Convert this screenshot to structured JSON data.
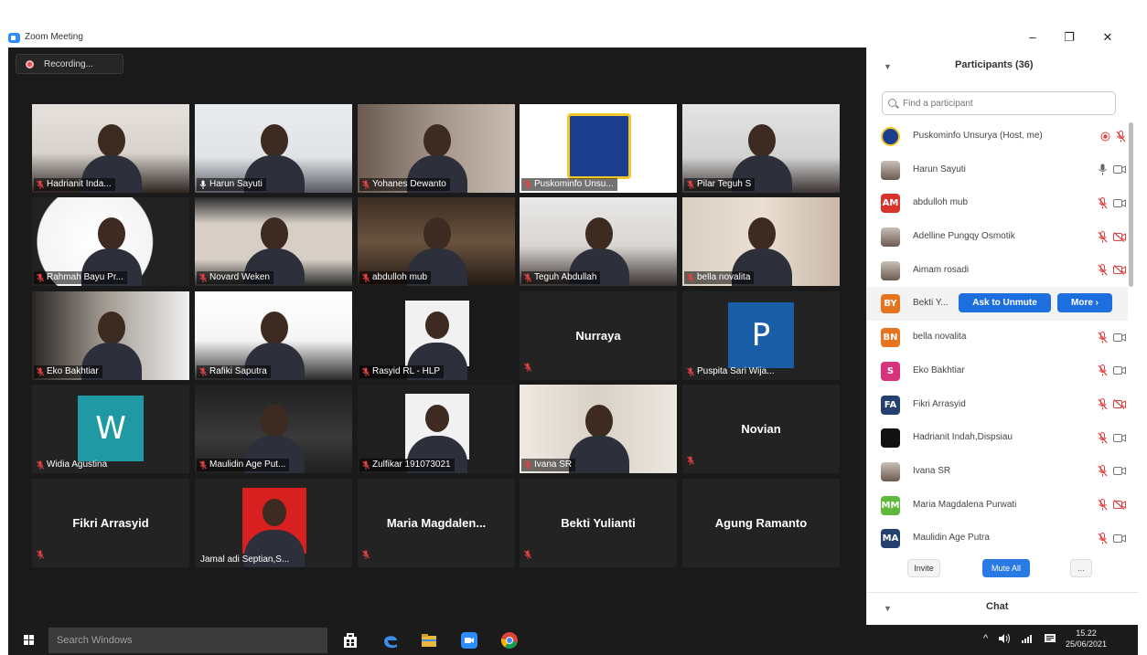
{
  "window": {
    "title": "Zoom Meeting",
    "controls": {
      "minimize": "–",
      "restore": "❐",
      "close": "✕"
    }
  },
  "recording": {
    "label": "Recording..."
  },
  "tiles": [
    {
      "name": "Hadrianit Inda...",
      "type": "video",
      "muted": true
    },
    {
      "name": "Harun Sayuti",
      "type": "video",
      "muted": false,
      "active": true
    },
    {
      "name": "Yohanes Dewanto",
      "type": "video",
      "muted": true
    },
    {
      "name": "Puskominfo Unsu...",
      "type": "video",
      "muted": true
    },
    {
      "name": "Pilar Teguh S",
      "type": "video",
      "muted": true
    },
    {
      "name": "Rahmah Bayu Pr...",
      "type": "video",
      "muted": true
    },
    {
      "name": "Novard Weken",
      "type": "video",
      "muted": true
    },
    {
      "name": "abdulloh mub",
      "type": "video",
      "muted": true
    },
    {
      "name": "Teguh Abdullah",
      "type": "video",
      "muted": true
    },
    {
      "name": "bella novalita",
      "type": "video",
      "muted": true
    },
    {
      "name": "Eko Bakhtiar",
      "type": "video",
      "muted": true
    },
    {
      "name": "Rafiki Saputra",
      "type": "video",
      "muted": true
    },
    {
      "name": "Rasyid RL - HLP",
      "type": "video",
      "muted": true
    },
    {
      "name": "Nurraya",
      "type": "name",
      "muted": true
    },
    {
      "name": "Puspita Sari Wija...",
      "type": "avatar",
      "letter": "P",
      "color": "#1a5ea8",
      "muted": true
    },
    {
      "name": "Widia Agustina",
      "type": "avatar",
      "letter": "W",
      "color": "#1f9aa5",
      "muted": true
    },
    {
      "name": "Maulidin Age Put...",
      "type": "video",
      "muted": true
    },
    {
      "name": "Zulfikar 191073021",
      "type": "video",
      "muted": true
    },
    {
      "name": "Ivana SR",
      "type": "video",
      "muted": true
    },
    {
      "name": "Novian",
      "type": "name",
      "muted": true
    },
    {
      "name": "Fikri Arrasyid",
      "type": "name",
      "muted": true
    },
    {
      "name": "Jamal adi Septian,S...",
      "type": "video",
      "muted": false
    },
    {
      "name": "Maria  Magdalen...",
      "type": "name",
      "muted": true
    },
    {
      "name": "Bekti Yulianti",
      "type": "name",
      "muted": true
    },
    {
      "name": "Agung Ramanto",
      "type": "name",
      "muted": false
    }
  ],
  "participants_panel": {
    "title": "Participants (36)",
    "search_placeholder": "Find a participant",
    "items": [
      {
        "name": "Puskominfo Unsurya (Host, me)",
        "avatar": "logo",
        "audio": "recording",
        "video": "mic-off"
      },
      {
        "name": "Harun Sayuti",
        "avatar": "photo",
        "audio": "mic-on",
        "video": "cam-on"
      },
      {
        "name": "abdulloh mub",
        "initials": "AM",
        "color": "#d9342b",
        "audio": "mic-off",
        "video": "cam-on"
      },
      {
        "name": "Adelline Pungqy Osmotik",
        "avatar": "photo",
        "audio": "mic-off",
        "video": "cam-off"
      },
      {
        "name": "Aimam rosadi",
        "avatar": "photo",
        "audio": "mic-off",
        "video": "cam-off"
      },
      {
        "name": "Bekti Y...",
        "initials": "BY",
        "color": "#e8731f",
        "ask_label": "Ask to Unmute",
        "more_label": "More ›"
      },
      {
        "name": "bella novalita",
        "initials": "BN",
        "color": "#e8731f",
        "audio": "mic-off",
        "video": "cam-on"
      },
      {
        "name": "Eko Bakhtiar",
        "initials": "S",
        "color": "#d6337a",
        "audio": "mic-off",
        "video": "cam-on"
      },
      {
        "name": "Fikri Arrasyid",
        "initials": "FA",
        "color": "#23406f",
        "audio": "mic-off",
        "video": "cam-off"
      },
      {
        "name": "Hadrianit Indah,Dispsiau",
        "avatar": "black",
        "audio": "mic-off",
        "video": "cam-on"
      },
      {
        "name": "Ivana SR",
        "avatar": "photo",
        "audio": "mic-off",
        "video": "cam-on"
      },
      {
        "name": "Maria Magdalena Purwati",
        "initials": "MM",
        "color": "#5fb83c",
        "audio": "mic-off",
        "video": "cam-off"
      },
      {
        "name": "Maulidin Age Putra",
        "initials": "MA",
        "color": "#23406f",
        "audio": "mic-off",
        "video": "cam-on"
      }
    ],
    "invite_label": "Invite",
    "mute_all_label": "Mute All",
    "more_label": "...",
    "chat_title": "Chat"
  },
  "taskbar": {
    "search_placeholder": "Search Windows",
    "time": "15.22",
    "date": "25/06/2021"
  }
}
